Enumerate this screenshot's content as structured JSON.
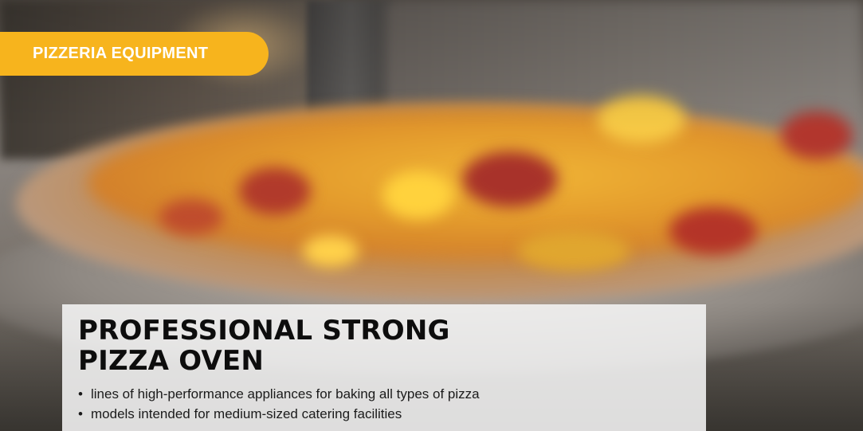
{
  "category": {
    "label": "PIZZERIA EQUIPMENT",
    "color": "#F7B41D"
  },
  "card": {
    "title_line1": "PROFESSIONAL STRONG",
    "title_line2": "PIZZA OVEN",
    "bullet_symbol": "•",
    "bullets": [
      "lines of high-performance appliances for baking all types of pizza",
      "models intended for medium-sized catering facilities"
    ]
  },
  "background": {
    "subject": "pizza-photo"
  }
}
